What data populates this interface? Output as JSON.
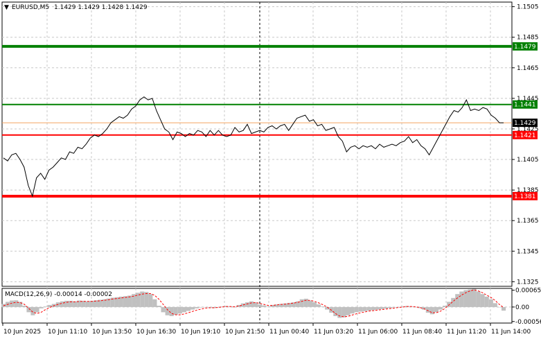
{
  "chart_header": {
    "arrow_icon": "triangle-down-icon",
    "symbol": "EURUSD,M5",
    "ohlc": "1.1429 1.1429 1.1428 1.1429"
  },
  "colors": {
    "background": "#ffffff",
    "grid": "#c8c8c8",
    "price_line": "#000000",
    "support_resistance_green": "#008000",
    "support_resistance_red": "#ff0000",
    "current_price_line": "#f4a460",
    "macd_histogram": "#c0c0c0",
    "macd_signal": "#ff0000"
  },
  "chart_data": {
    "type": "line",
    "symbol": "EURUSD",
    "timeframe": "M5",
    "x_ticks": [
      "10 Jun 2025",
      "10 Jun 11:10",
      "10 Jun 13:50",
      "10 Jun 16:30",
      "10 Jun 19:10",
      "10 Jun 21:50",
      "11 Jun 00:40",
      "11 Jun 03:20",
      "11 Jun 06:00",
      "11 Jun 08:40",
      "11 Jun 11:20",
      "11 Jun 14:00"
    ],
    "y_ticks": [
      "1.1505",
      "1.1485",
      "1.1465",
      "1.1445",
      "1.1425",
      "1.1405",
      "1.1385",
      "1.1365",
      "1.1345",
      "1.1325"
    ],
    "ylim": [
      1.1322,
      1.1508
    ],
    "grid": true,
    "series": [
      {
        "values": [
          1.1406,
          1.1404,
          1.1408,
          1.1409,
          1.1405,
          1.14,
          1.1388,
          1.1381,
          1.1393,
          1.1396,
          1.1392,
          1.1398,
          1.14,
          1.1403,
          1.1406,
          1.1405,
          1.141,
          1.1409,
          1.1413,
          1.1412,
          1.1415,
          1.1419,
          1.1421,
          1.142,
          1.1422,
          1.1425,
          1.1429,
          1.1431,
          1.1433,
          1.1432,
          1.1434,
          1.1438,
          1.144,
          1.1444,
          1.1446,
          1.1444,
          1.1445,
          1.1437,
          1.1431,
          1.1425,
          1.1423,
          1.1418,
          1.1423,
          1.1422,
          1.142,
          1.1422,
          1.1421,
          1.1424,
          1.1423,
          1.142,
          1.1424,
          1.1421,
          1.1424,
          1.1421,
          1.142,
          1.1421,
          1.1426,
          1.1423,
          1.1424,
          1.1428,
          1.1422,
          1.1423,
          1.1424,
          1.1423,
          1.1426,
          1.1427,
          1.1425,
          1.1427,
          1.1428,
          1.1424,
          1.1428,
          1.1432,
          1.1433,
          1.1434,
          1.143,
          1.1431,
          1.1427,
          1.1428,
          1.1424,
          1.1425,
          1.1426,
          1.142,
          1.1417,
          1.141,
          1.1413,
          1.1414,
          1.1412,
          1.1414,
          1.1413,
          1.1414,
          1.1412,
          1.1415,
          1.1413,
          1.1414,
          1.1415,
          1.1414,
          1.1416,
          1.1417,
          1.142,
          1.1416,
          1.1418,
          1.1414,
          1.1412,
          1.1408,
          1.1413,
          1.1418,
          1.1423,
          1.1428,
          1.1433,
          1.1437,
          1.1436,
          1.1439,
          1.1444,
          1.1437,
          1.1438,
          1.1437,
          1.1439,
          1.1438,
          1.1434,
          1.1432,
          1.1429,
          1.1429
        ],
        "x_range": [
          "10 Jun 2025",
          "11 Jun 14:00"
        ]
      }
    ],
    "horizontal_levels": [
      {
        "value": "1.1479",
        "color": "#008000"
      },
      {
        "value": "1.1441",
        "color": "#008000"
      },
      {
        "value": "1.1429",
        "color": "#f4a460"
      },
      {
        "value": "1.1421",
        "color": "#ff0000"
      },
      {
        "value": "1.1381",
        "color": "#ff0000"
      }
    ],
    "price_tags": [
      {
        "text": "1.1479",
        "bg": "#008000"
      },
      {
        "text": "1.1441",
        "bg": "#008000"
      },
      {
        "text": "1.1429",
        "bg": "#000000"
      },
      {
        "text": "1.1421",
        "bg": "#ff0000"
      },
      {
        "text": "1.1381",
        "bg": "#ff0000"
      }
    ],
    "macd": {
      "title": "MACD(12,26,9) -0.00014 -0.00002",
      "y_ticks": [
        "0.00065",
        "0.00",
        "-0.00056"
      ],
      "ylim": [
        -0.00062,
        0.00072
      ],
      "histogram": [
        0.00012,
        0.0002,
        0.00025,
        0.00026,
        0.0002,
        5e-05,
        -0.0002,
        -0.00032,
        -0.0002,
        -5e-05,
        2e-05,
        8e-05,
        0.00012,
        0.00018,
        0.00022,
        0.00024,
        0.00024,
        0.00022,
        0.00025,
        0.00024,
        0.00022,
        0.00024,
        0.00026,
        0.00028,
        0.0003,
        0.00033,
        0.00036,
        0.00038,
        0.0004,
        0.00042,
        0.00044,
        0.0005,
        0.00055,
        0.0006,
        0.00058,
        0.0005,
        0.0003,
        5e-05,
        -0.0002,
        -0.00032,
        -0.00035,
        -0.0003,
        -0.00025,
        -0.0002,
        -0.00015,
        -0.0001,
        -5e-05,
        -2e-05,
        0.0,
        -2e-05,
        -4e-05,
        -2e-05,
        2e-05,
        4e-05,
        2e-05,
        0.0,
        8e-05,
        0.00014,
        0.00018,
        0.00022,
        0.00018,
        0.0001,
        6e-05,
        2e-05,
        8e-05,
        0.0001,
        0.00012,
        0.00014,
        0.00016,
        0.00018,
        0.00022,
        0.0003,
        0.00032,
        0.00025,
        0.00018,
        0.0001,
        2e-05,
        -0.0001,
        -0.00022,
        -0.00035,
        -0.00042,
        -0.0004,
        -0.00032,
        -0.00025,
        -0.0002,
        -0.00018,
        -0.00016,
        -0.00014,
        -0.00012,
        -0.0001,
        -8e-05,
        -6e-05,
        -4e-05,
        -2e-05,
        0.0,
        2e-05,
        4e-05,
        2e-05,
        0.0,
        -4e-05,
        -0.0001,
        -0.00022,
        -0.00028,
        -0.0002,
        -0.0001,
        5e-05,
        0.0002,
        0.00035,
        0.0005,
        0.0006,
        0.00065,
        0.00068,
        0.0007,
        0.0006,
        0.0005,
        0.0004,
        0.0003,
        0.00015,
        0.0,
        -0.00014
      ],
      "signal": [
        5e-05,
        0.0001,
        0.00015,
        0.00018,
        0.00017,
        0.0001,
        -5e-05,
        -0.0002,
        -0.00025,
        -0.0002,
        -0.0001,
        -2e-05,
        5e-05,
        0.0001,
        0.00015,
        0.00018,
        0.0002,
        0.0002,
        0.00021,
        0.00022,
        0.00022,
        0.00022,
        0.00023,
        0.00024,
        0.00026,
        0.00028,
        0.00031,
        0.00033,
        0.00035,
        0.00037,
        0.00039,
        0.00042,
        0.00046,
        0.0005,
        0.00052,
        0.00052,
        0.00045,
        0.0003,
        0.0001,
        -0.0001,
        -0.00025,
        -0.0003,
        -0.0003,
        -0.00027,
        -0.00022,
        -0.00017,
        -0.00012,
        -8e-05,
        -4e-05,
        -3e-05,
        -3e-05,
        -2e-05,
        0.0,
        2e-05,
        2e-05,
        1e-05,
        4e-05,
        8e-05,
        0.00012,
        0.00016,
        0.00017,
        0.00014,
        0.0001,
        6e-05,
        6e-05,
        8e-05,
        0.0001,
        0.00011,
        0.00013,
        0.00015,
        0.00018,
        0.00022,
        0.00026,
        0.00026,
        0.00022,
        0.00016,
        9e-05,
        0.0,
        -0.00012,
        -0.00025,
        -0.00035,
        -0.00038,
        -0.00036,
        -0.00031,
        -0.00026,
        -0.00022,
        -0.00019,
        -0.00016,
        -0.00014,
        -0.00012,
        -0.0001,
        -8e-05,
        -6e-05,
        -4e-05,
        -2e-05,
        0.0,
        2e-05,
        2e-05,
        1e-05,
        -2e-05,
        -6e-05,
        -0.00014,
        -0.00022,
        -0.00022,
        -0.00016,
        -6e-05,
        8e-05,
        0.00022,
        0.00035,
        0.00046,
        0.00055,
        0.00062,
        0.00066,
        0.00062,
        0.00055,
        0.00046,
        0.00037,
        0.00025,
        0.0001,
        -2e-05
      ]
    }
  }
}
